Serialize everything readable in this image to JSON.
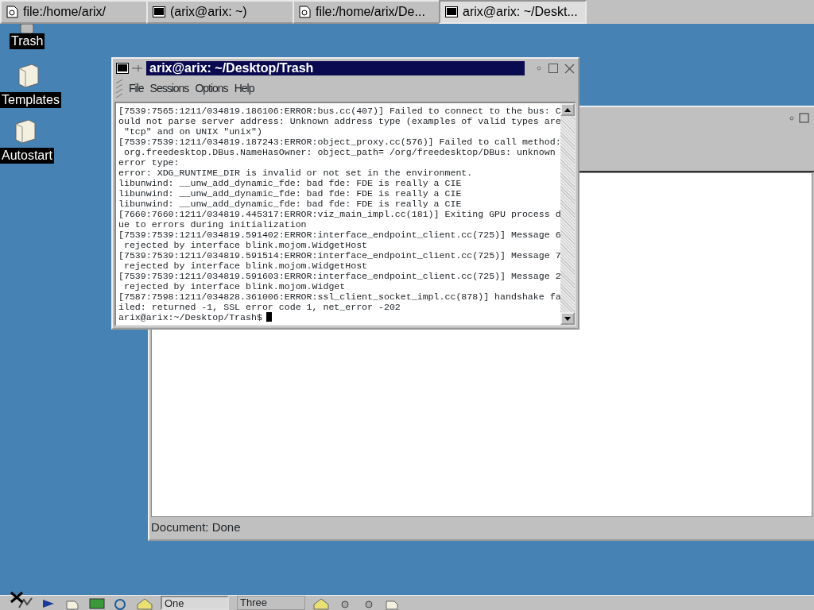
{
  "top_taskbar": {
    "tabs": [
      {
        "label": "file:/home/arix/",
        "kind": "file",
        "selected": false
      },
      {
        "label": "(arix@arix: ~)",
        "kind": "terminal",
        "selected": false
      },
      {
        "label": "file:/home/arix/De...",
        "kind": "file",
        "selected": false
      },
      {
        "label": "arix@arix: ~/Deskt...",
        "kind": "terminal",
        "selected": true
      }
    ]
  },
  "desktop_icons": [
    {
      "label": "Trash",
      "kind": "trash"
    },
    {
      "label": "Templates",
      "kind": "folder"
    },
    {
      "label": "Autostart",
      "kind": "folder"
    }
  ],
  "browser_window": {
    "status": "Document: Done"
  },
  "terminal": {
    "title": "arix@arix: ~/Desktop/Trash",
    "menu": [
      "File",
      "Sessions",
      "Options",
      "Help"
    ],
    "lines": [
      "[7539:7565:1211/034819.186106:ERROR:bus.cc(407)] Failed to connect to the bus: C",
      "ould not parse server address: Unknown address type (examples of valid types are",
      " \"tcp\" and on UNIX \"unix\")",
      "[7539:7539:1211/034819.187243:ERROR:object_proxy.cc(576)] Failed to call method:",
      " org.freedesktop.DBus.NameHasOwner: object_path= /org/freedesktop/DBus: unknown",
      "error type:",
      "error: XDG_RUNTIME_DIR is invalid or not set in the environment.",
      "libunwind: __unw_add_dynamic_fde: bad fde: FDE is really a CIE",
      "libunwind: __unw_add_dynamic_fde: bad fde: FDE is really a CIE",
      "libunwind: __unw_add_dynamic_fde: bad fde: FDE is really a CIE",
      "[7660:7660:1211/034819.445317:ERROR:viz_main_impl.cc(181)] Exiting GPU process d",
      "ue to errors during initialization",
      "[7539:7539:1211/034819.591402:ERROR:interface_endpoint_client.cc(725)] Message 6",
      " rejected by interface blink.mojom.WidgetHost",
      "[7539:7539:1211/034819.591514:ERROR:interface_endpoint_client.cc(725)] Message 7",
      " rejected by interface blink.mojom.WidgetHost",
      "[7539:7539:1211/034819.591603:ERROR:interface_endpoint_client.cc(725)] Message 2",
      " rejected by interface blink.mojom.Widget",
      "[7587:7598:1211/034828.361006:ERROR:ssl_client_socket_impl.cc(878)] handshake fa",
      "iled: returned -1, SSL error code 1, net_error -202"
    ],
    "prompt": "arix@arix:~/Desktop/Trash$"
  },
  "bottom_panel": {
    "tasks": [
      {
        "label": "One",
        "selected": true
      },
      {
        "label": "Three",
        "selected": false
      }
    ]
  }
}
